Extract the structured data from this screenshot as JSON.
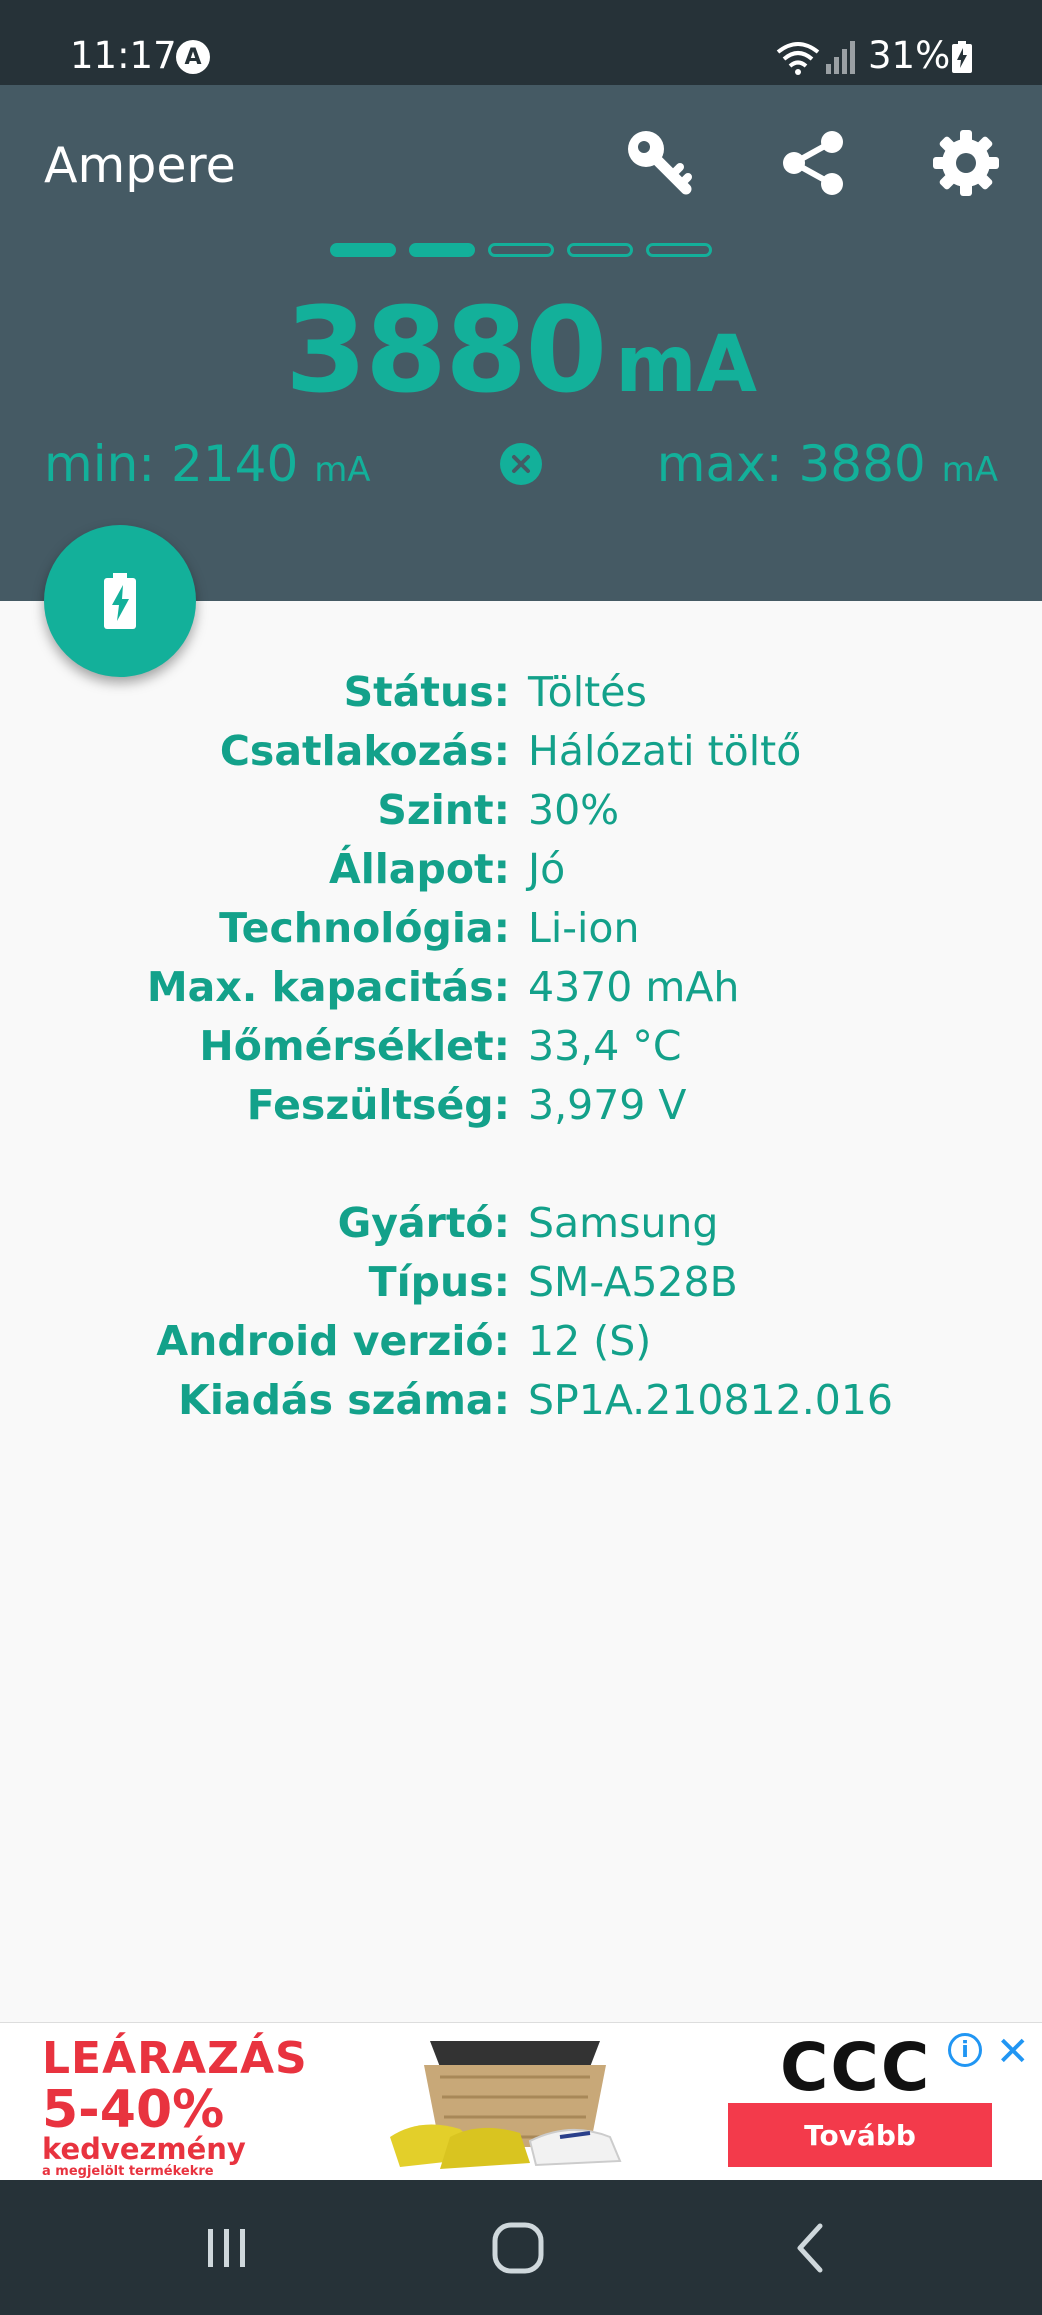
{
  "status_bar": {
    "time": "11:17",
    "notification_icon_letter": "A",
    "battery_percent": "31%",
    "icons": [
      "wifi-icon",
      "signal-icon",
      "battery-charging-icon"
    ]
  },
  "header": {
    "app_title": "Ampere",
    "icons": [
      "key-icon",
      "share-icon",
      "settings-gear-icon"
    ],
    "level_segments_filled": 2,
    "level_segments_total": 5,
    "current_value": "3880",
    "current_unit": "mA",
    "min_label": "min: 2140",
    "min_unit": "mA",
    "max_label": "max: 3880",
    "max_unit": "mA"
  },
  "colors": {
    "accent": "#13b09a",
    "header_bg": "#455a64",
    "system_bar_bg": "#263238",
    "content_bg": "#f9f9f9"
  },
  "battery_info": [
    {
      "label": "Státus:",
      "value": "Töltés"
    },
    {
      "label": "Csatlakozás:",
      "value": "Hálózati töltő"
    },
    {
      "label": "Szint:",
      "value": "30%"
    },
    {
      "label": "Állapot:",
      "value": "Jó"
    },
    {
      "label": "Technológia:",
      "value": "Li-ion"
    },
    {
      "label": "Max. kapacitás:",
      "value": "4370 mAh"
    },
    {
      "label": "Hőmérséklet:",
      "value": "33,4 °C"
    },
    {
      "label": "Feszültség:",
      "value": "3,979 V"
    }
  ],
  "device_info": [
    {
      "label": "Gyártó:",
      "value": "Samsung"
    },
    {
      "label": "Típus:",
      "value": "SM-A528B"
    },
    {
      "label": "Android verzió:",
      "value": "12 (S)"
    },
    {
      "label": "Kiadás száma:",
      "value": "SP1A.210812.016"
    }
  ],
  "ad": {
    "title": "LEÁRAZÁS",
    "discount": "5-40%",
    "subtitle": "kedvezmény",
    "small_print": "a megjelölt termékekre",
    "brand": "CCC",
    "button_label": "Tovább",
    "info_icon_glyph": "i",
    "close_icon_glyph": "✕"
  },
  "nav_bar": {
    "buttons": [
      "recents-button",
      "home-button",
      "back-button"
    ]
  }
}
